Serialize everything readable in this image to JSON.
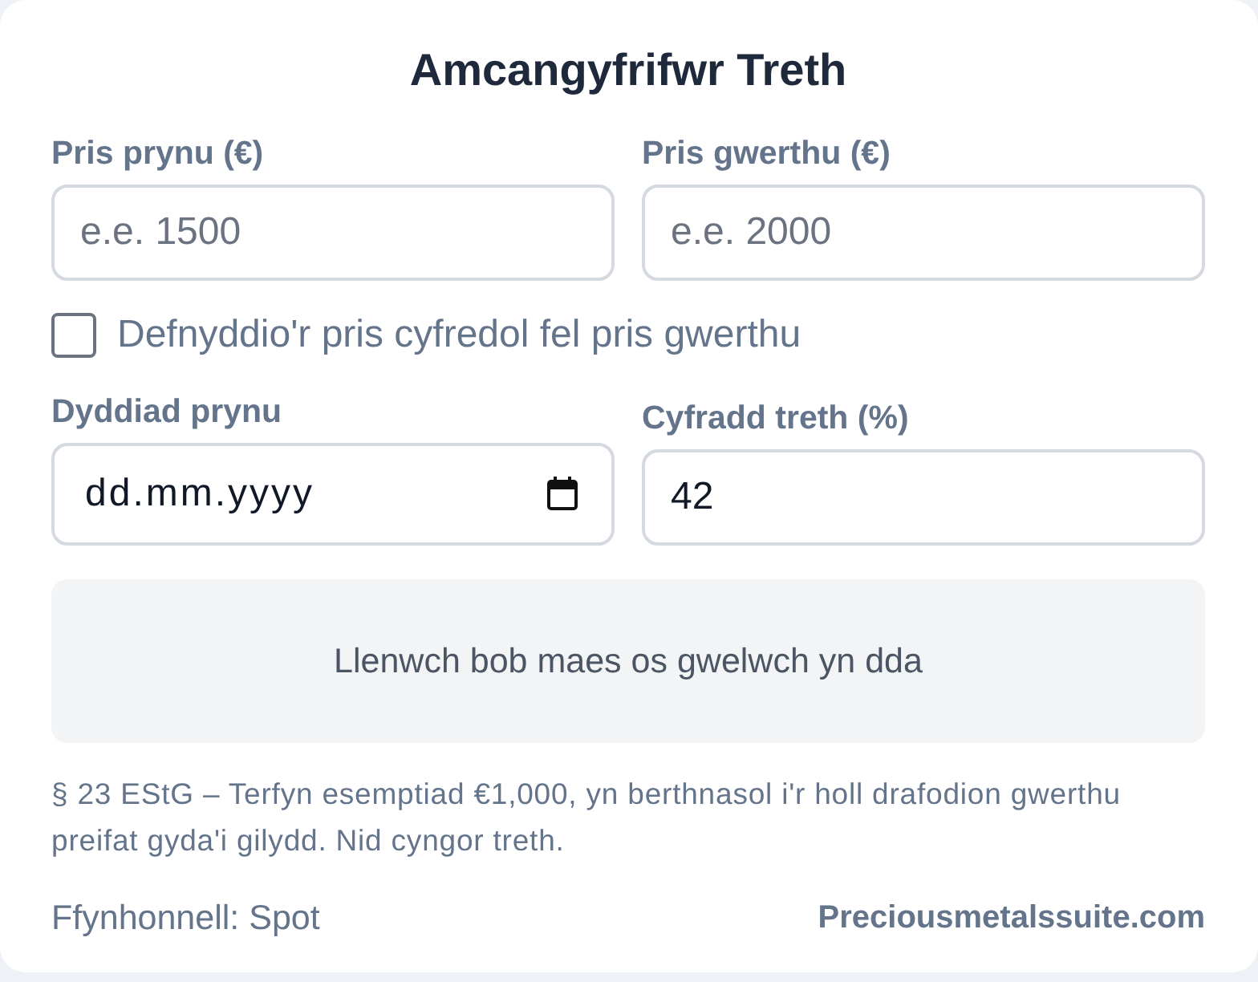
{
  "title": "Amcangyfrifwr Treth",
  "price_fields": [
    {
      "label": "Pris prynu (€)",
      "kind": "number",
      "placeholder": "e.e. 1500"
    },
    {
      "label": "Pris gwerthu (€)",
      "kind": "number",
      "placeholder": "e.e. 2000"
    }
  ],
  "spot_checkbox": {
    "label": "Defnyddio'r pris cyfredol fel pris gwerthu",
    "checked": false
  },
  "detail_fields": [
    {
      "label": "Dyddiad prynu",
      "kind": "date",
      "placeholder": "dd.mm.yyyy"
    },
    {
      "label": "Cyfradd treth (%)",
      "kind": "number",
      "value": "42"
    }
  ],
  "result": {
    "message": "Llenwch bob maes os gwelwch yn dda"
  },
  "footnote": "§ 23 EStG – Terfyn esemptiad €1,000, yn berthnasol i'r holl drafodion gwerthu preifat gyda'i gilydd. Nid cyngor treth.",
  "footer": {
    "source": "Ffynhonnell: Spot",
    "brand": "Preciousmetalssuite.com"
  }
}
